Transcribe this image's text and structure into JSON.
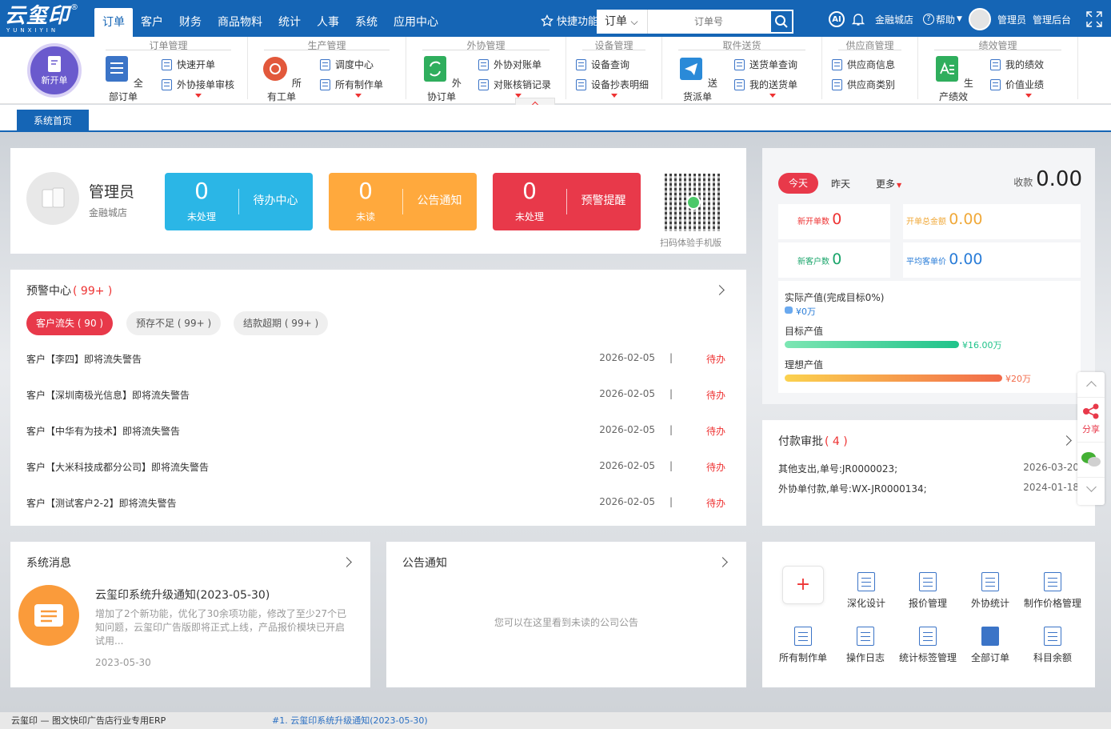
{
  "app": {
    "logo": "云玺印",
    "logo_sub": "YUNXIYIN",
    "logo_reg": "®"
  },
  "nav": [
    "订单",
    "客户",
    "财务",
    "商品物料",
    "统计",
    "人事",
    "系统",
    "应用中心"
  ],
  "header": {
    "quick": "快捷功能",
    "search_select": "订单",
    "search_placeholder": "订单号",
    "store": "金融城店",
    "help": "帮助",
    "user": "管理员",
    "admin": "管理后台"
  },
  "ribbon": {
    "new_order": "新开单",
    "groups": [
      {
        "title": "订单管理",
        "big": "全部订单",
        "items": [
          "快速开单",
          "外协接单审核"
        ]
      },
      {
        "title": "生产管理",
        "big": "所有工单",
        "items": [
          "调度中心",
          "所有制作单"
        ]
      },
      {
        "title": "外协管理",
        "big": "外协订单",
        "items": [
          "外协对账单",
          "对账核销记录"
        ]
      },
      {
        "title": "设备管理",
        "items": [
          "设备查询",
          "设备抄表明细"
        ]
      },
      {
        "title": "取件送货",
        "big": "送货派单",
        "items": [
          "送货单查询",
          "我的送货单"
        ]
      },
      {
        "title": "供应商管理",
        "items": [
          "供应商信息",
          "供应商类别"
        ]
      },
      {
        "title": "绩效管理",
        "big": "生产绩效",
        "items": [
          "我的绩效",
          "价值业绩"
        ]
      }
    ]
  },
  "tabs": {
    "home": "系统首页"
  },
  "profile": {
    "name": "管理员",
    "store": "金融城店",
    "qr_caption": "扫码体验手机版"
  },
  "stats": [
    {
      "num": "0",
      "sub": "未处理",
      "label": "待办中心",
      "color": "#2bb6e6"
    },
    {
      "num": "0",
      "sub": "未读",
      "label": "公告通知",
      "color": "#ffa93d"
    },
    {
      "num": "0",
      "sub": "未处理",
      "label": "预警提醒",
      "color": "#e8394a"
    }
  ],
  "warning": {
    "title": "预警中心",
    "count": "( 99+ )",
    "pills": [
      "客户流失 ( 90 )",
      "预存不足 ( 99+ )",
      "结款超期 ( 99+ )"
    ],
    "rows": [
      {
        "text": "客户【李四】即将流失警告",
        "date": "2026-02-05",
        "status": "待办"
      },
      {
        "text": "客户【深圳南极光信息】即将流失警告",
        "date": "2026-02-05",
        "status": "待办"
      },
      {
        "text": "客户【中华有为技术】即将流失警告",
        "date": "2026-02-05",
        "status": "待办"
      },
      {
        "text": "客户【大米科技成都分公司】即将流失警告",
        "date": "2026-02-05",
        "status": "待办"
      },
      {
        "text": "客户【测试客户2-2】即将流失警告",
        "date": "2026-02-05",
        "status": "待办"
      }
    ],
    "sep": "|"
  },
  "today": {
    "tabs": [
      "今天",
      "昨天",
      "更多"
    ],
    "receipt_label": "收款",
    "receipt_value": "0.00",
    "kpis": [
      {
        "label": "新开单数",
        "value": "0"
      },
      {
        "label": "开单总金额",
        "value": "0.00"
      },
      {
        "label": "新客户数",
        "value": "0"
      },
      {
        "label": "平均客单价",
        "value": "0.00"
      }
    ],
    "actual_label": "实际产值(完成目标0%)",
    "actual_value": "¥0万",
    "target_label": "目标产值",
    "target_value": "¥16.00万",
    "ideal_label": "理想产值",
    "ideal_value": "¥20万"
  },
  "payment": {
    "title": "付款审批",
    "count": "( 4 )",
    "rows": [
      {
        "text": "其他支出,单号:JR0000023;",
        "date": "2026-03-20"
      },
      {
        "text": "外协单付款,单号:WX-JR0000134;",
        "date": "2024-01-18"
      }
    ]
  },
  "sysmsg": {
    "title": "系统消息",
    "headline": "云玺印系统升级通知(2023-05-30)",
    "body": "增加了2个新功能，优化了30余项功能，修改了至少27个已知问题，云玺印广告版即将正式上线，产品报价模块已开启试用...",
    "date": "2023-05-30"
  },
  "notice": {
    "title": "公告通知",
    "empty": "您可以在这里看到未读的公司公告"
  },
  "quick_actions": [
    "深化设计",
    "报价管理",
    "外协统计",
    "制作价格管理",
    "所有制作单",
    "操作日志",
    "统计标签管理",
    "全部订单",
    "科目余额"
  ],
  "quick_add": "+",
  "side": {
    "share": "分享"
  },
  "footer": {
    "left": "云玺印 — 图文快印广告店行业专用ERP",
    "marquee": "#1. 云玺印系统升级通知(2023-05-30)"
  },
  "colors": {
    "primary": "#1565b5",
    "red": "#e8394a",
    "cyan": "#2bb6e6",
    "orange": "#ffa93d"
  }
}
